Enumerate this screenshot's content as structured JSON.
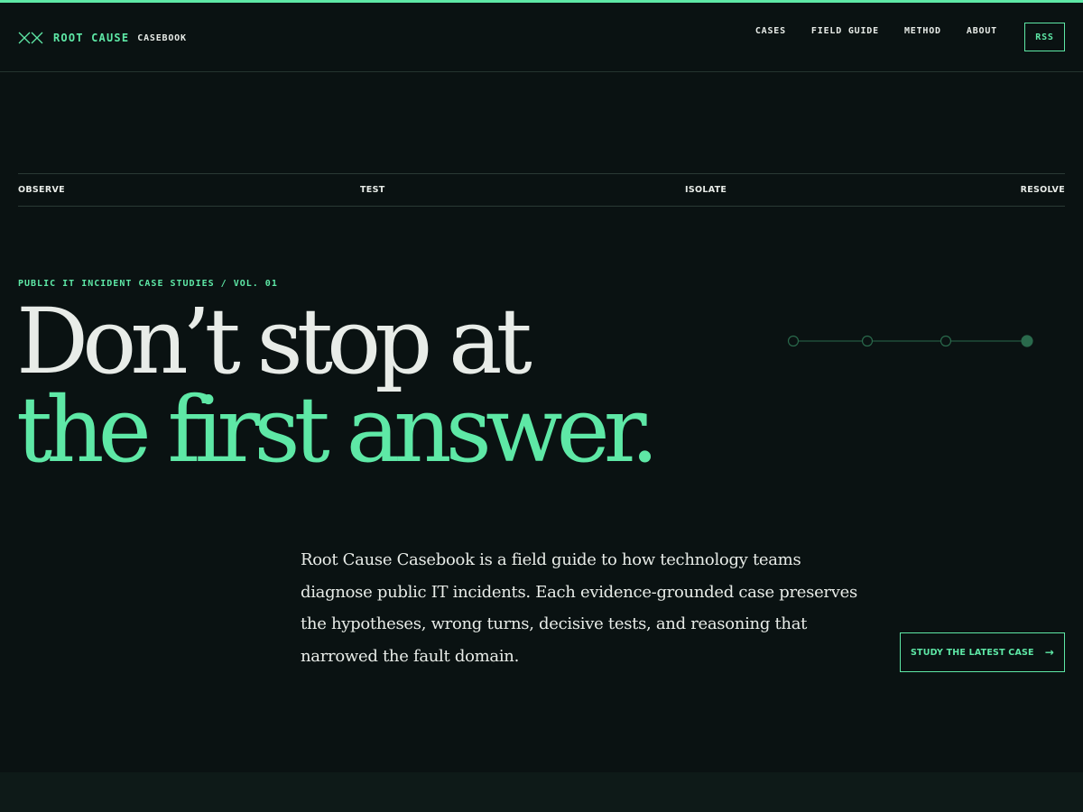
{
  "brand": {
    "name": "ROOT CAUSE",
    "sub": "CASEBOOK",
    "icon": "double-x-icon"
  },
  "nav": {
    "items": [
      {
        "label": "CASES"
      },
      {
        "label": "FIELD GUIDE"
      },
      {
        "label": "METHOD"
      },
      {
        "label": "ABOUT"
      }
    ],
    "rss_label": "RSS"
  },
  "steps": [
    "OBSERVE",
    "TEST",
    "ISOLATE",
    "RESOLVE"
  ],
  "hero": {
    "eyebrow": "PUBLIC IT INCIDENT CASE STUDIES / VOL. 01",
    "headline_line1": "Don’t stop at",
    "headline_line2": "the first answer.",
    "intro": "Root Cause Casebook is a field guide to how technology teams diagnose public IT incidents. Each evidence-grounded case preserves the hypotheses, wrong turns, decisive tests, and reasoning that narrowed the fault domain.",
    "cta_label": "STUDY THE LATEST CASE",
    "cta_icon": "arrow-right-icon",
    "progress": {
      "steps_total": 4,
      "active_step": 4
    }
  },
  "colors": {
    "accent": "#5ee8a6",
    "background": "#0a1212",
    "text": "#e8ece8",
    "rule": "#2a3a35",
    "track": "#2a6a4c"
  }
}
